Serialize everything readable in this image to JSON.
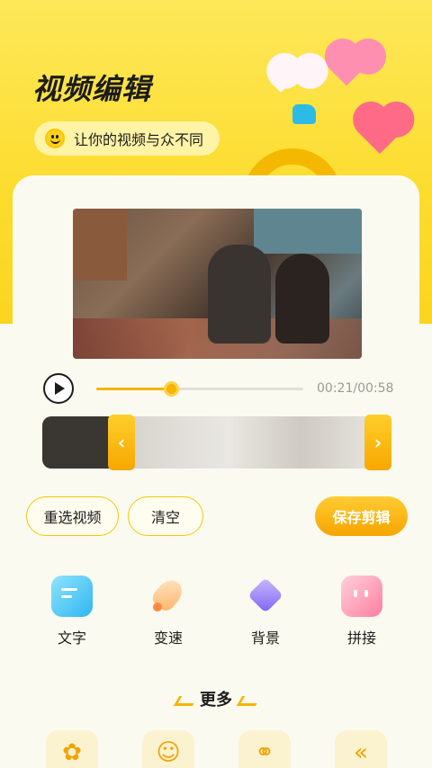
{
  "header": {
    "title": "视频编辑",
    "tagline": "让你的视频与众不同"
  },
  "player": {
    "time": "00:21/00:58",
    "progress": 0.36
  },
  "actions": {
    "reselect": "重选视频",
    "clear": "清空",
    "save": "保存剪辑"
  },
  "tools": [
    {
      "label": "文字",
      "icon": "text-icon"
    },
    {
      "label": "变速",
      "icon": "rocket-icon"
    },
    {
      "label": "背景",
      "icon": "paint-bucket-icon"
    },
    {
      "label": "拼接",
      "icon": "splice-icon"
    }
  ],
  "more": {
    "label": "更多"
  },
  "colors": {
    "accent": "#f5b400",
    "hero": "#fddc2e"
  }
}
